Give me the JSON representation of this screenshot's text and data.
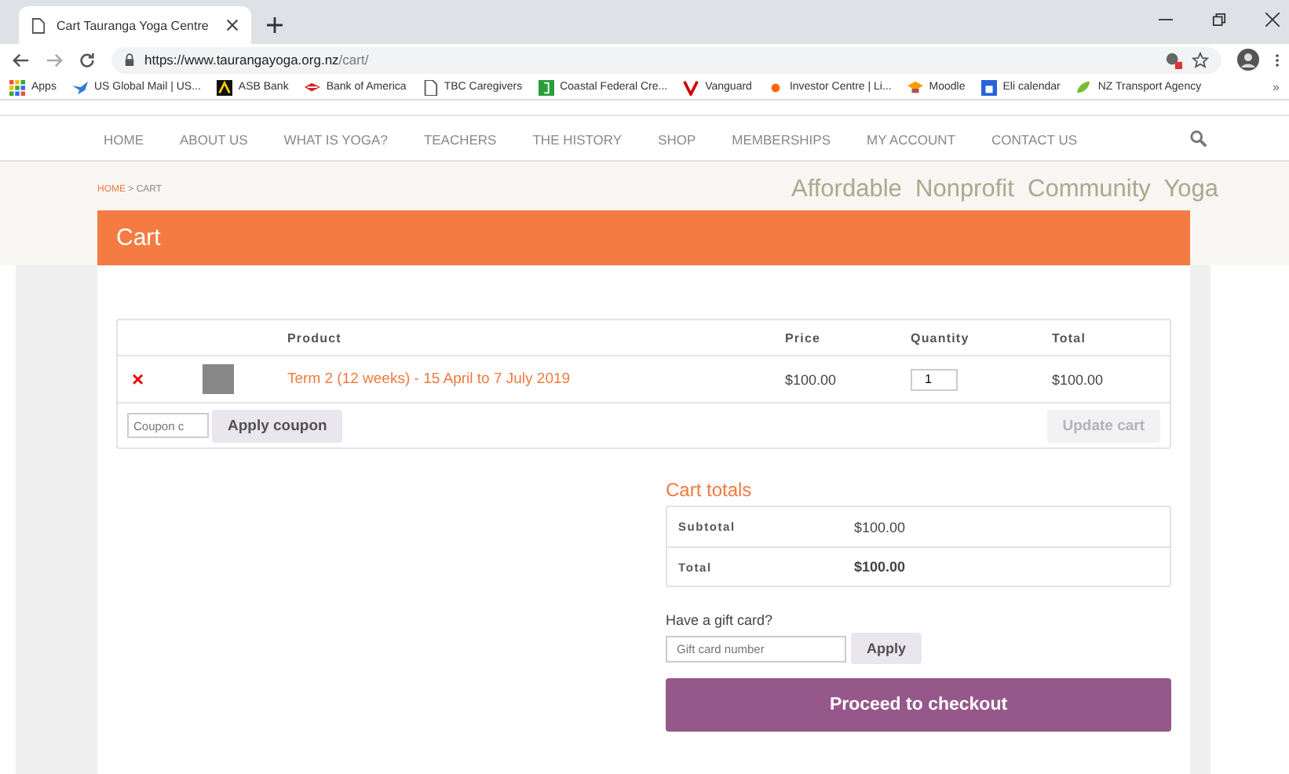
{
  "browser": {
    "tab_title": "Cart Tauranga Yoga Centre",
    "url_host": "https://www.taurangayoga.org.nz",
    "url_path": "/cart/",
    "bookmarks": [
      {
        "label": "Apps",
        "kind": "apps"
      },
      {
        "label": "US Global Mail | US...",
        "kind": "bird"
      },
      {
        "label": "ASB Bank",
        "kind": "square"
      },
      {
        "label": "Bank of America",
        "kind": "flag"
      },
      {
        "label": "TBC Caregivers",
        "kind": "page"
      },
      {
        "label": "Coastal Federal Cre...",
        "kind": "green"
      },
      {
        "label": "Vanguard",
        "kind": "v"
      },
      {
        "label": "Investor Centre | Li...",
        "kind": "dot"
      },
      {
        "label": "Moodle",
        "kind": "hat"
      },
      {
        "label": "Eli calendar",
        "kind": "calendar"
      },
      {
        "label": "NZ Transport Agency",
        "kind": "leaf"
      }
    ],
    "overflow": "»"
  },
  "nav": [
    {
      "label": "HOME"
    },
    {
      "label": "ABOUT US"
    },
    {
      "label": "WHAT IS YOGA?"
    },
    {
      "label": "TEACHERS"
    },
    {
      "label": "THE HISTORY"
    },
    {
      "label": "SHOP"
    },
    {
      "label": "MEMBERSHIPS"
    },
    {
      "label": "MY ACCOUNT"
    },
    {
      "label": "CONTACT US"
    }
  ],
  "breadcrumb": {
    "link": "HOME",
    "separator": " > ",
    "current": "CART"
  },
  "tagline": "Affordable  Nonprofit  Community  Yoga",
  "page_title": "Cart",
  "cart_table": {
    "columns": [
      "Product",
      "Price",
      "Quantity",
      "Total"
    ],
    "rows": [
      {
        "remove": "×",
        "product": "Term 2 (12 weeks) - 15 April to 7 July 2019",
        "price": "$100.00",
        "quantity": "1",
        "total": "$100.00"
      }
    ],
    "coupon_placeholder": "Coupon c",
    "apply_coupon": "Apply coupon",
    "update_cart": "Update cart",
    "update_disabled": true
  },
  "cart_totals": {
    "title": "Cart totals",
    "rows": [
      {
        "label": "Subtotal",
        "value": "$100.00",
        "bold": false
      },
      {
        "label": "Total",
        "value": "$100.00",
        "bold": true
      }
    ]
  },
  "gift_card": {
    "label": "Have a gift card?",
    "placeholder": "Gift card number",
    "button": "Apply"
  },
  "checkout_button": "Proceed to checkout"
}
